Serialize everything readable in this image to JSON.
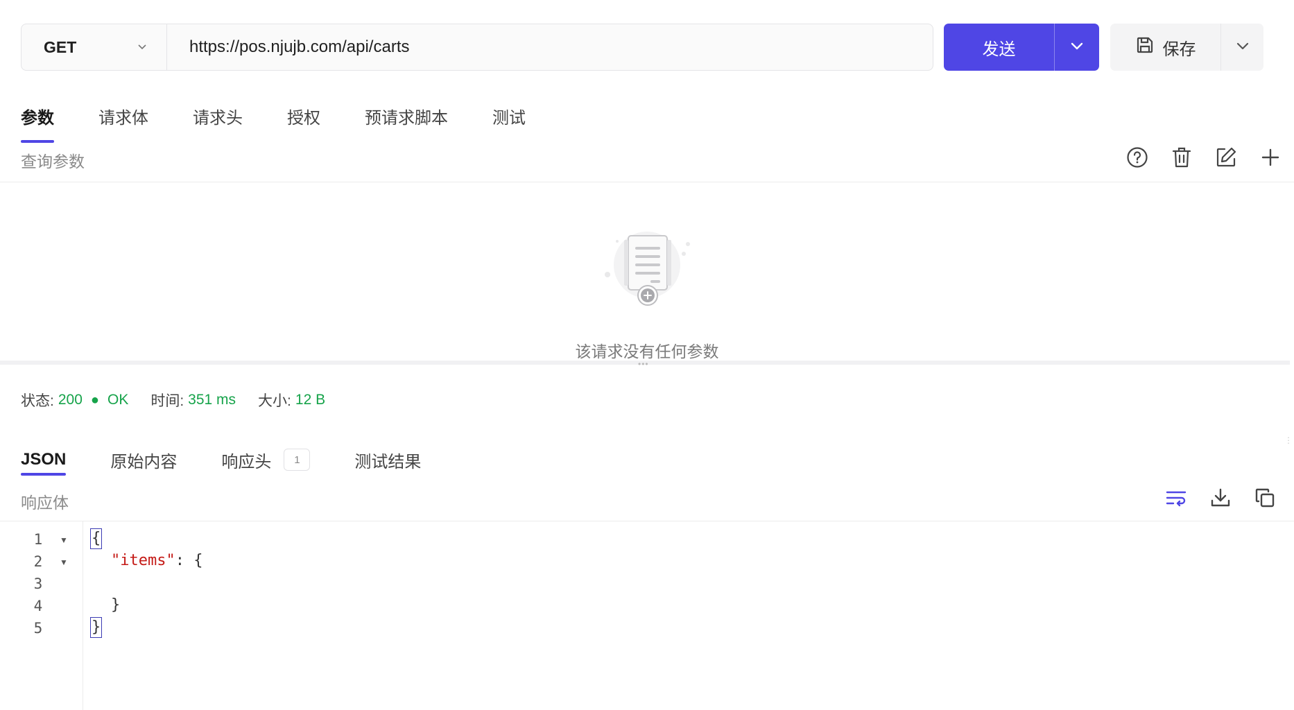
{
  "request": {
    "method": "GET",
    "url": "https://pos.njujb.com/api/carts",
    "send_label": "发送",
    "save_label": "保存"
  },
  "request_tabs": [
    {
      "label": "参数",
      "active": true
    },
    {
      "label": "请求体",
      "active": false
    },
    {
      "label": "请求头",
      "active": false
    },
    {
      "label": "授权",
      "active": false
    },
    {
      "label": "预请求脚本",
      "active": false
    },
    {
      "label": "测试",
      "active": false
    }
  ],
  "params": {
    "section_title": "查询参数",
    "empty_text": "该请求没有任何参数",
    "icons": [
      "help-icon",
      "trash-icon",
      "edit-icon",
      "plus-icon"
    ]
  },
  "status": {
    "status_label": "状态:",
    "status_code": "200",
    "status_text": "OK",
    "time_label": "时间:",
    "time_value": "351 ms",
    "size_label": "大小:",
    "size_value": "12 B"
  },
  "response_tabs": [
    {
      "label": "JSON",
      "active": true
    },
    {
      "label": "原始内容",
      "active": false
    },
    {
      "label": "响应头",
      "active": false,
      "badge": "1"
    },
    {
      "label": "测试结果",
      "active": false
    }
  ],
  "response": {
    "section_title": "响应体",
    "icons": [
      "wrap-lines-icon",
      "download-icon",
      "copy-icon"
    ],
    "line_numbers": [
      "1",
      "2",
      "3",
      "4",
      "5"
    ],
    "lines": [
      "{",
      "\"items\"",
      ": {",
      "}",
      "}"
    ]
  },
  "colors": {
    "accent": "#4f46e5",
    "success": "#16a34a",
    "json_string": "#c41a16"
  }
}
